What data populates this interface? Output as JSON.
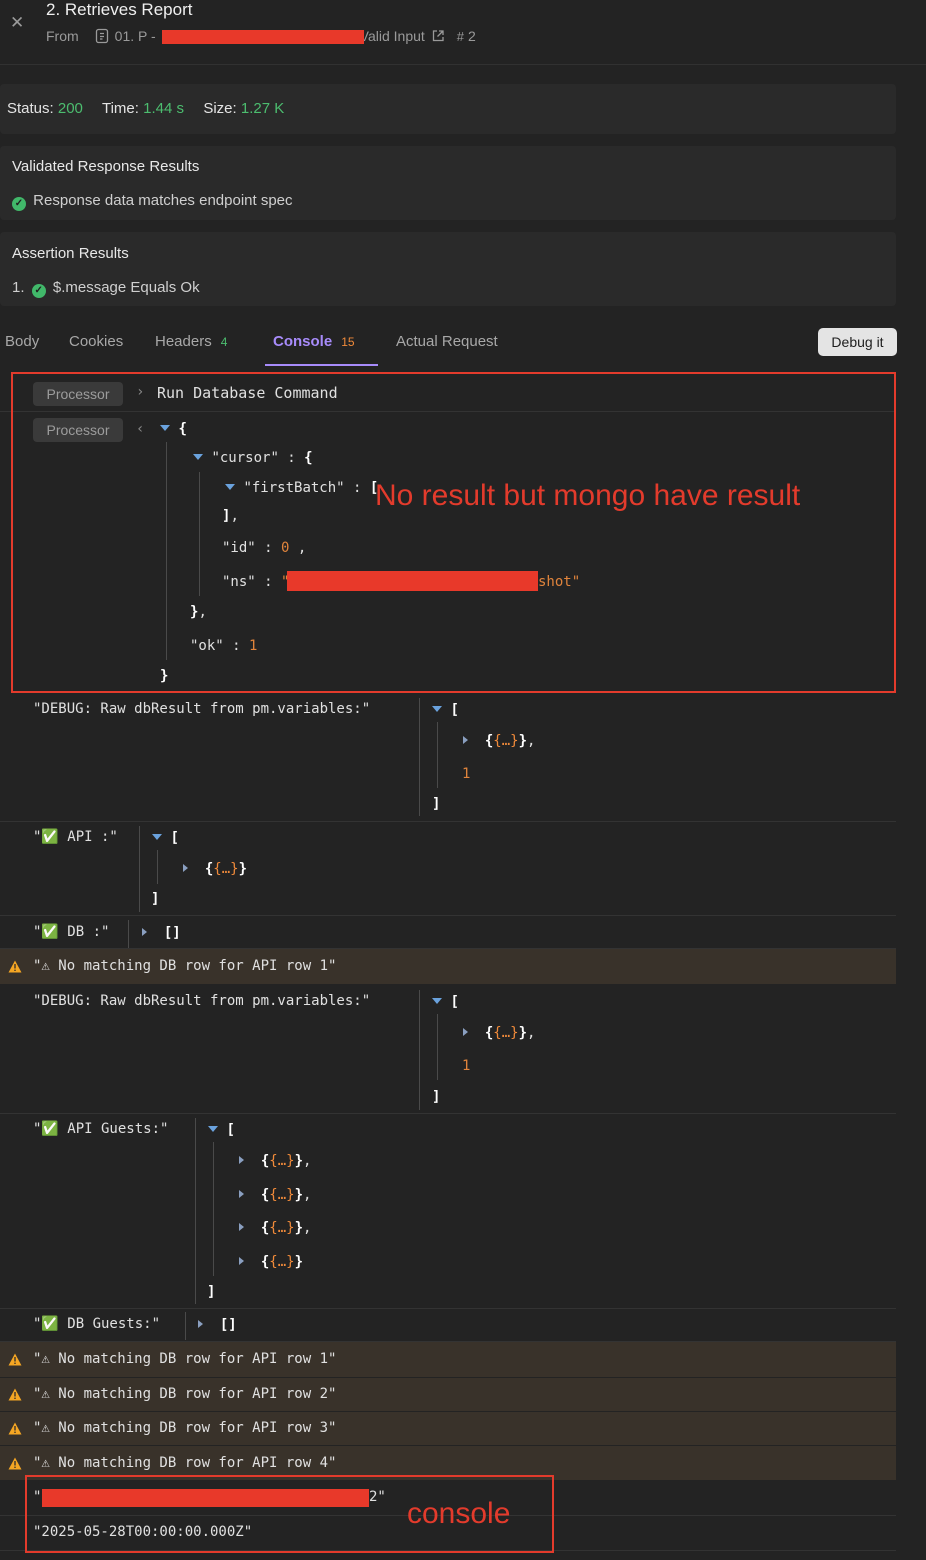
{
  "header": {
    "title": "2. Retrieves Report",
    "from_label": "From",
    "source_prefix": "01. P -",
    "source_suffix": "Valid Input",
    "run_number": "2",
    "close_icon": "close-icon"
  },
  "status": {
    "status_label": "Status:",
    "status_value": "200",
    "time_label": "Time:",
    "time_value": "1.44 s",
    "size_label": "Size:",
    "size_value": "1.27 K",
    "value_color": "#4cbd6f"
  },
  "validation": {
    "title": "Validated Response Results",
    "result": "Response data matches endpoint spec"
  },
  "assertions": {
    "title": "Assertion Results",
    "items": [
      {
        "index": "1.",
        "text": "$.message Equals Ok"
      }
    ]
  },
  "tabs": [
    {
      "label": "Body"
    },
    {
      "label": "Cookies"
    },
    {
      "label": "Headers",
      "count": "4"
    },
    {
      "label": "Console",
      "count": "15",
      "active": true
    },
    {
      "label": "Actual Request"
    }
  ],
  "debug_button": "Debug it",
  "console": {
    "processor_label": "Processor",
    "run_command": "Run Database Command",
    "db_result": {
      "cursor_key": "\"cursor\"",
      "first_batch_key": "\"firstBatch\"",
      "id_key": "\"id\"",
      "id_value": "0",
      "ns_key": "\"ns\"",
      "ns_value_visible": "shot\"",
      "ok_key": "\"ok\"",
      "ok_value": "1"
    },
    "entries": {
      "debug_raw": "\"DEBUG: Raw dbResult from pm.variables:\"",
      "api": "\"✅ API :\"",
      "db": "\"✅ DB :\"",
      "warn_1": "\"⚠ No matching DB row for API row 1\"",
      "api_guests": "\"✅ API Guests:\"",
      "db_guests": "\"✅ DB Guests:\"",
      "warn_row_1": "\"⚠ No matching DB row for API row 1\"",
      "warn_row_2": "\"⚠ No matching DB row for API row 2\"",
      "warn_row_3": "\"⚠ No matching DB row for API row 3\"",
      "warn_row_4": "\"⚠ No matching DB row for API row 4\"",
      "redacted_suffix": "2\"",
      "date": "\"2025-05-28T00:00:00.000Z\""
    },
    "raw_array_num": "1",
    "collapsed_object": "{…}",
    "empty_array": "[]"
  },
  "annotations": {
    "note": "No result but mongo have result",
    "console_label": "console",
    "color": "#e33b2c"
  }
}
